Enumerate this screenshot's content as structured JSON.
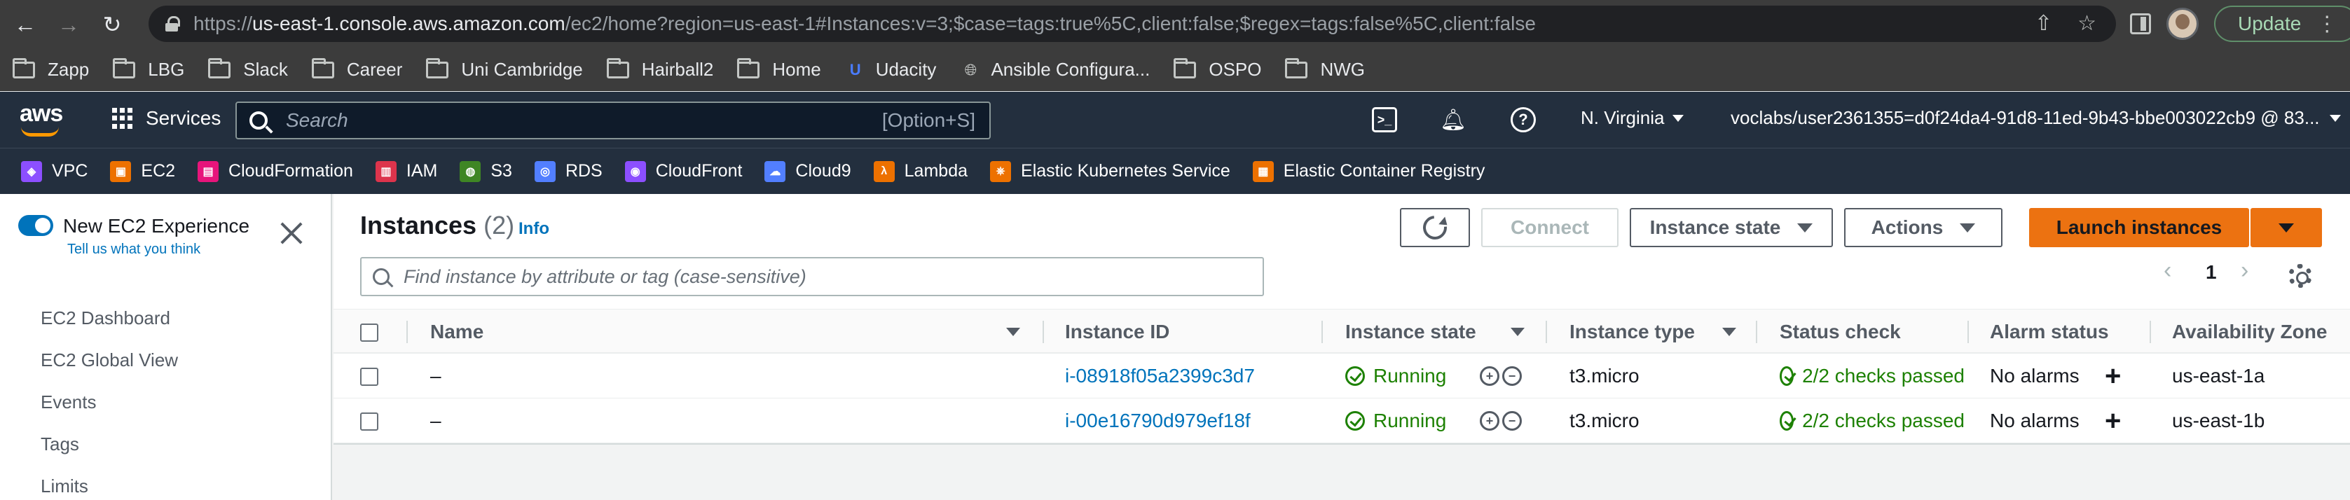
{
  "browser": {
    "url_prefix": "https://",
    "url_host": "us-east-1.console.aws.amazon.com",
    "url_rest": "/ec2/home?region=us-east-1#Instances:v=3;$case=tags:true%5C,client:false;$regex=tags:false%5C,client:false",
    "update_label": "Update",
    "bookmarks": [
      {
        "label": "Zapp",
        "icon": "folder-icon"
      },
      {
        "label": "LBG",
        "icon": "folder-icon"
      },
      {
        "label": "Slack",
        "icon": "folder-icon"
      },
      {
        "label": "Career",
        "icon": "folder-icon"
      },
      {
        "label": "Uni Cambridge",
        "icon": "folder-icon"
      },
      {
        "label": "Hairball2",
        "icon": "folder-icon"
      },
      {
        "label": "Home",
        "icon": "folder-icon"
      },
      {
        "label": "Udacity",
        "icon": "udacity-icon"
      },
      {
        "label": "Ansible Configura...",
        "icon": "globe-icon"
      },
      {
        "label": "OSPO",
        "icon": "folder-icon"
      },
      {
        "label": "NWG",
        "icon": "folder-icon"
      }
    ]
  },
  "aws": {
    "logo_text": "aws",
    "services_label": "Services",
    "search_placeholder": "Search",
    "search_shortcut": "[Option+S]",
    "region_label": "N. Virginia",
    "account_label": "voclabs/user2361355=d0f24da4-91d8-11ed-9b43-bbe003022cb9 @ 83...",
    "favorites": [
      {
        "label": "VPC",
        "color": "#8c4fff"
      },
      {
        "label": "EC2",
        "color": "#ed7100"
      },
      {
        "label": "CloudFormation",
        "color": "#e7157b"
      },
      {
        "label": "IAM",
        "color": "#dd344c"
      },
      {
        "label": "S3",
        "color": "#3f8624"
      },
      {
        "label": "RDS",
        "color": "#527fff"
      },
      {
        "label": "CloudFront",
        "color": "#8c4fff"
      },
      {
        "label": "Cloud9",
        "color": "#527fff"
      },
      {
        "label": "Lambda",
        "color": "#ed7100"
      },
      {
        "label": "Elastic Kubernetes Service",
        "color": "#ed7100"
      },
      {
        "label": "Elastic Container Registry",
        "color": "#ed7100"
      }
    ]
  },
  "sidebar": {
    "experience_title": "New EC2 Experience",
    "experience_sub": "Tell us what you think",
    "items": [
      "EC2 Dashboard",
      "EC2 Global View",
      "Events",
      "Tags",
      "Limits"
    ]
  },
  "main": {
    "title": "Instances",
    "count": "(2)",
    "info": "Info",
    "connect_label": "Connect",
    "instance_state_label": "Instance state",
    "actions_label": "Actions",
    "launch_label": "Launch instances",
    "find_placeholder": "Find instance by attribute or tag (case-sensitive)",
    "page_number": "1",
    "columns": [
      "Name",
      "Instance ID",
      "Instance state",
      "Instance type",
      "Status check",
      "Alarm status",
      "Availability Zone"
    ],
    "rows": [
      {
        "name": "–",
        "id": "i-08918f05a2399c3d7",
        "state": "Running",
        "type": "t3.micro",
        "status": "2/2 checks passed",
        "alarm": "No alarms",
        "az": "us-east-1a"
      },
      {
        "name": "–",
        "id": "i-00e16790d979ef18f",
        "state": "Running",
        "type": "t3.micro",
        "status": "2/2 checks passed",
        "alarm": "No alarms",
        "az": "us-east-1b"
      }
    ]
  }
}
